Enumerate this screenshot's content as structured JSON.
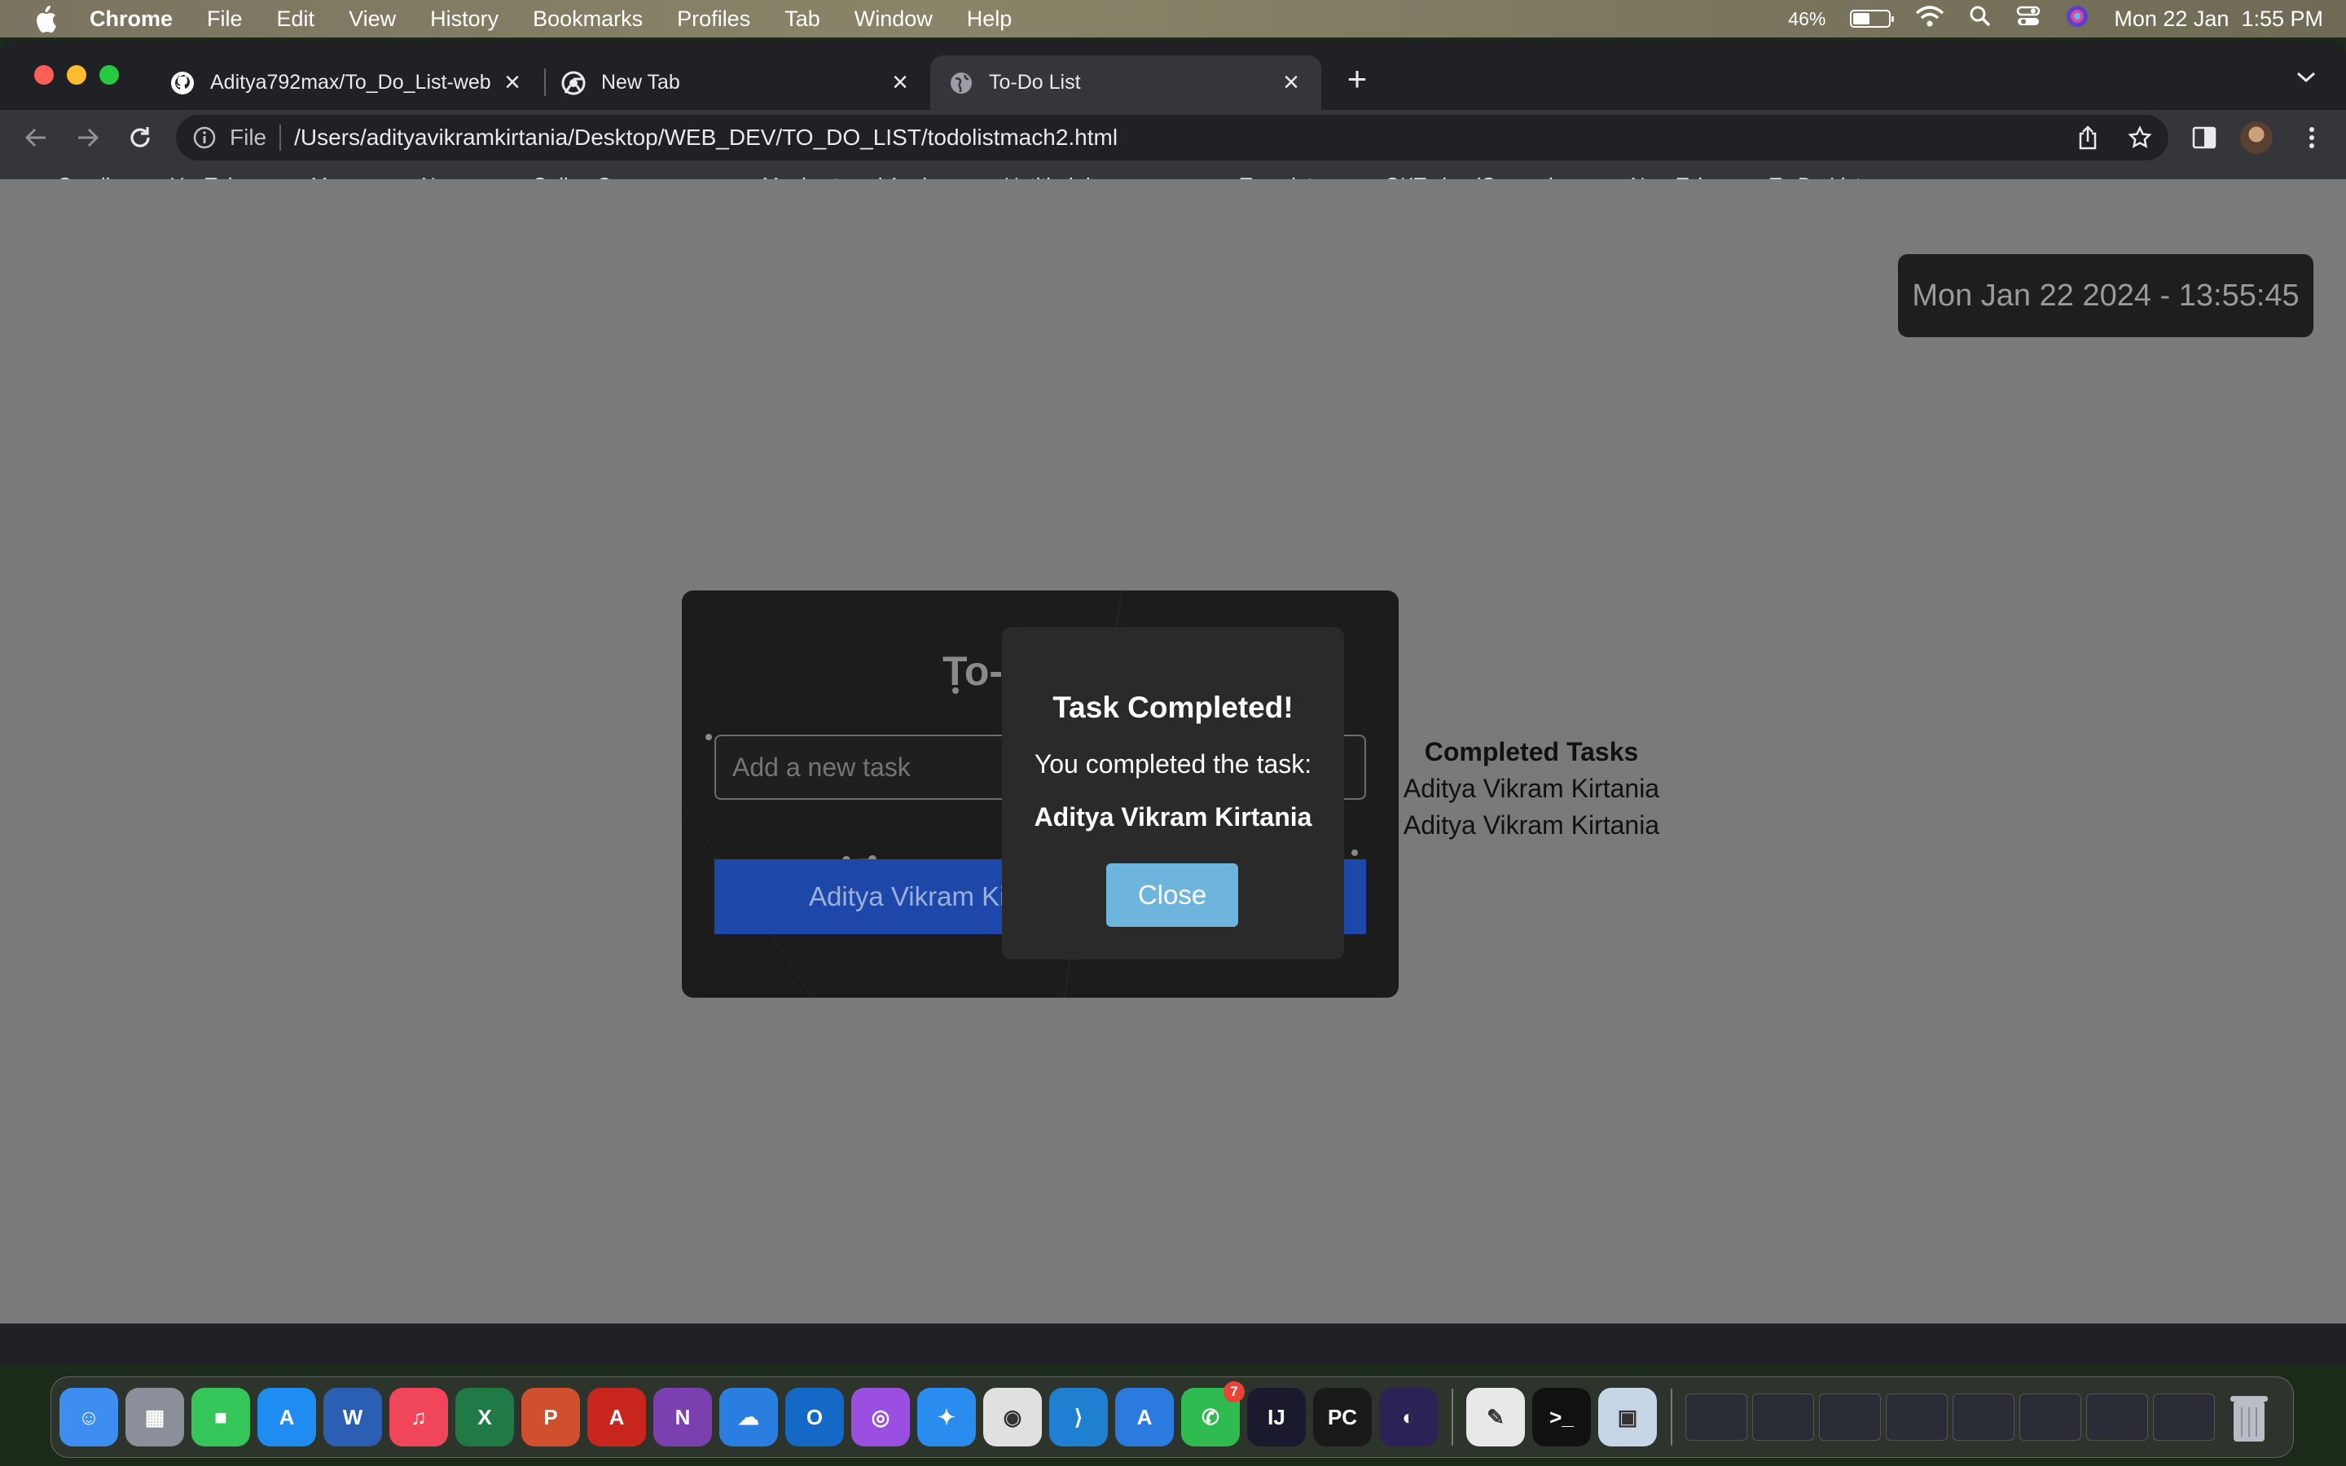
{
  "menubar": {
    "app_name": "Chrome",
    "items": [
      "File",
      "Edit",
      "View",
      "History",
      "Bookmarks",
      "Profiles",
      "Tab",
      "Window",
      "Help"
    ],
    "battery": "46%",
    "battery_level": 0.46,
    "datetime": "Mon 22 Jan  1:55 PM"
  },
  "tabs": [
    {
      "title": "Aditya792max/To_Do_List-web",
      "icon": "github-icon",
      "active": false
    },
    {
      "title": "New Tab",
      "icon": "chrome-icon",
      "active": false
    },
    {
      "title": "To-Do List",
      "icon": "globe-icon",
      "active": true
    }
  ],
  "toolbar": {
    "scheme": "File",
    "url": "/Users/adityavikramkirtania/Desktop/WEB_DEV/TO_DO_LIST/todolistmach2.html"
  },
  "bookmarks": [
    {
      "label": "Gmail",
      "icon": "gmail-icon",
      "color": "#ea4335",
      "glyph": "M"
    },
    {
      "label": "YouTube",
      "icon": "youtube-icon",
      "color": "#ff0000",
      "glyph": "▶"
    },
    {
      "label": "Maps",
      "icon": "maps-icon",
      "color": "#34a853",
      "glyph": "●"
    },
    {
      "label": "News",
      "icon": "news-icon",
      "color": "#4285f4",
      "glyph": "G"
    },
    {
      "label": "Online Courses -...",
      "icon": "courses-icon",
      "color": "#7b3fe4",
      "glyph": "U"
    },
    {
      "label": "Monkeytype | A mi...",
      "icon": "monkeytype-icon",
      "color": "#e2b714",
      "glyph": "mt"
    },
    {
      "label": "Untitled documen...",
      "icon": "docs-icon",
      "color": "#4285f4",
      "glyph": "≡"
    },
    {
      "label": "Translate",
      "icon": "translate-icon",
      "color": "#4285f4",
      "glyph": "G"
    },
    {
      "label": "GKToday (General...",
      "icon": "gktoday-icon",
      "color": "#f4b400",
      "glyph": "★"
    },
    {
      "label": "New Tab",
      "icon": "globe-icon",
      "color": "#9aa0a6",
      "glyph": "◉"
    },
    {
      "label": "To-Do List",
      "icon": "globe-icon",
      "color": "#9aa0a6",
      "glyph": "◉"
    }
  ],
  "page": {
    "clock": "Mon Jan 22 2024 - 13:55:45",
    "todo_title": "To-",
    "input_placeholder": "Add a new task",
    "task_text": "Aditya Vikram Ki",
    "completed_heading": "Completed Tasks",
    "completed_items": [
      "Aditya Vikram Kirtania",
      "Aditya Vikram Kirtania"
    ]
  },
  "modal": {
    "title": "Task Completed!",
    "message": "You completed the task:",
    "task": "Aditya Vikram Kirtania",
    "close_label": "Close"
  },
  "dock": {
    "apps": [
      {
        "name": "finder-icon",
        "color": "#3d8ef0",
        "glyph": "☺"
      },
      {
        "name": "launchpad-icon",
        "color": "#8a8f99",
        "glyph": "▦"
      },
      {
        "name": "facetime-icon",
        "color": "#35c659",
        "glyph": "■"
      },
      {
        "name": "app-store-icon",
        "color": "#1e8cf0",
        "glyph": "A"
      },
      {
        "name": "word-icon",
        "color": "#2b5fb4",
        "glyph": "W"
      },
      {
        "name": "music-icon",
        "color": "#f0455a",
        "glyph": "♫"
      },
      {
        "name": "excel-icon",
        "color": "#1f7a45",
        "glyph": "X"
      },
      {
        "name": "powerpoint-icon",
        "color": "#d0502e",
        "glyph": "P"
      },
      {
        "name": "acrobat-icon",
        "color": "#c8251c",
        "glyph": "A"
      },
      {
        "name": "onenote-icon",
        "color": "#7b3fb0",
        "glyph": "N"
      },
      {
        "name": "onedrive-icon",
        "color": "#2a7ee0",
        "glyph": "☁"
      },
      {
        "name": "outlook-icon",
        "color": "#1469c7",
        "glyph": "O"
      },
      {
        "name": "podcasts-icon",
        "color": "#9a4fe0",
        "glyph": "◎"
      },
      {
        "name": "safari-icon",
        "color": "#2b8cf0",
        "glyph": "✦"
      },
      {
        "name": "chrome-icon",
        "color": "#e0e0e0",
        "glyph": "◉"
      },
      {
        "name": "vscode-icon",
        "color": "#1f7fd1",
        "glyph": "⟩"
      },
      {
        "name": "xcode-icon",
        "color": "#2a7ae0",
        "glyph": "A"
      },
      {
        "name": "whatsapp-icon",
        "color": "#2fbb4f",
        "glyph": "✆",
        "badge": "7"
      },
      {
        "name": "intellij-icon",
        "color": "#1a1a2e",
        "glyph": "IJ"
      },
      {
        "name": "pycharm-icon",
        "color": "#1a1a1a",
        "glyph": "PC"
      },
      {
        "name": "eclipse-icon",
        "color": "#2c2255",
        "glyph": "◐"
      }
    ],
    "utilities": [
      {
        "name": "textedit-icon",
        "color": "#e8e8e8",
        "glyph": "✎"
      },
      {
        "name": "terminal-icon",
        "color": "#111111",
        "glyph": ">_"
      },
      {
        "name": "preview-icon",
        "color": "#c7d6e6",
        "glyph": "▣"
      }
    ],
    "minimized_count": 8,
    "trash_color": "#b9bec6"
  }
}
